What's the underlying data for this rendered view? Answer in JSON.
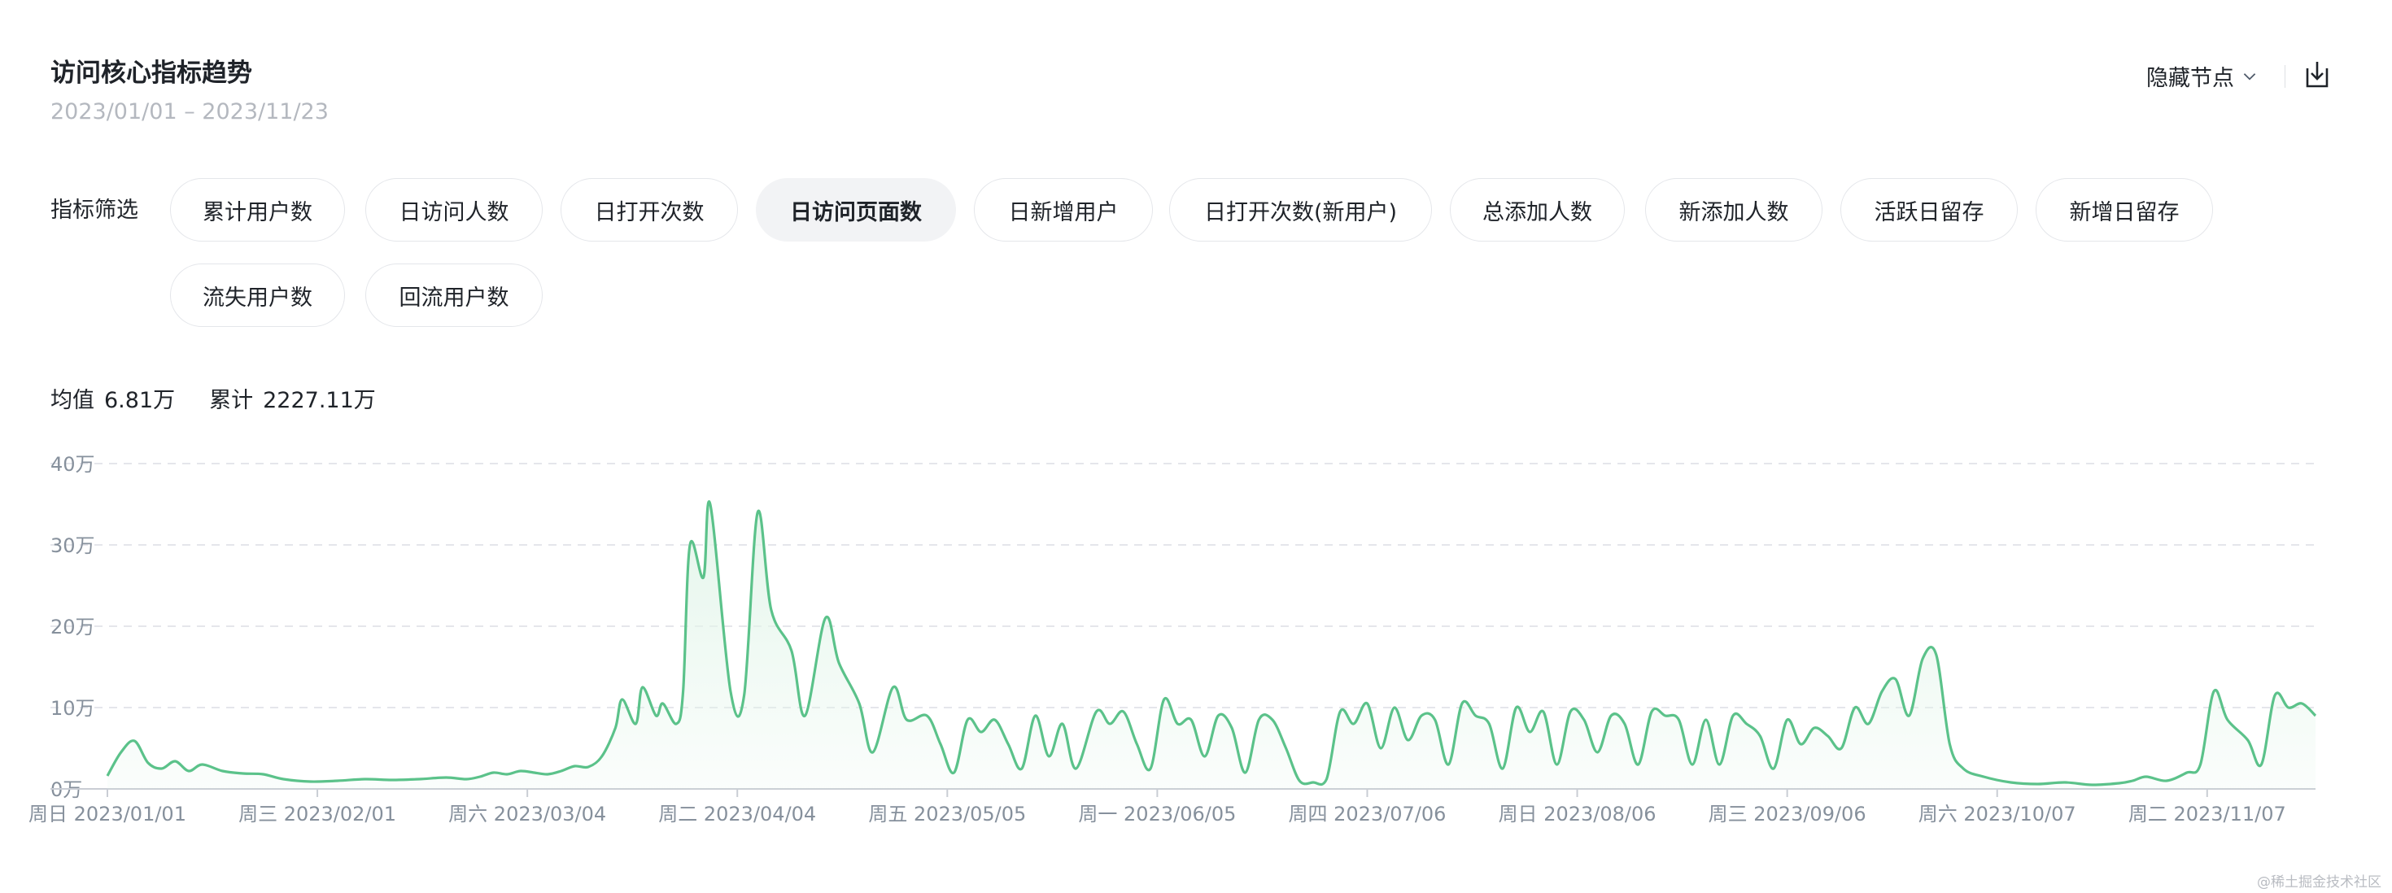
{
  "header": {
    "title": "访问核心指标趋势",
    "date_range": "2023/01/01 – 2023/11/23",
    "hide_nodes_label": "隐藏节点"
  },
  "filters": {
    "label": "指标筛选",
    "items": [
      {
        "label": "累计用户数"
      },
      {
        "label": "日访问人数"
      },
      {
        "label": "日打开次数"
      },
      {
        "label": "日访问页面数",
        "active": true
      },
      {
        "label": "日新增用户"
      },
      {
        "label": "日打开次数(新用户)"
      },
      {
        "label": "总添加人数"
      },
      {
        "label": "新添加人数"
      },
      {
        "label": "活跃日留存"
      },
      {
        "label": "新增日留存"
      },
      {
        "label": "流失用户数"
      },
      {
        "label": "回流用户数"
      }
    ]
  },
  "stats": {
    "mean_label": "均值",
    "mean_value": "6.81万",
    "total_label": "累计",
    "total_value": "2227.11万"
  },
  "watermark": "@稀土掘金技术社区",
  "colors": {
    "line": "#5bc28a",
    "area_top": "#e3f5ea",
    "grid": "#e5e6eb",
    "axis_text": "#86909c",
    "active_pill": "#f2f3f5"
  },
  "chart_data": {
    "type": "area",
    "y_unit": "万",
    "ylim": [
      0,
      40
    ],
    "y_ticks": [
      0,
      10,
      20,
      30,
      40
    ],
    "y_tick_labels": [
      "0万",
      "10万",
      "20万",
      "30万",
      "40万"
    ],
    "xlim": [
      "2023-01-01",
      "2023-11-23"
    ],
    "x_tick_labels": [
      {
        "date": "2023-01-01",
        "label": "周日 2023/01/01"
      },
      {
        "date": "2023-02-01",
        "label": "周三 2023/02/01"
      },
      {
        "date": "2023-03-04",
        "label": "周六 2023/03/04"
      },
      {
        "date": "2023-04-04",
        "label": "周二 2023/04/04"
      },
      {
        "date": "2023-05-05",
        "label": "周五 2023/05/05"
      },
      {
        "date": "2023-06-05",
        "label": "周一 2023/06/05"
      },
      {
        "date": "2023-07-06",
        "label": "周四 2023/07/06"
      },
      {
        "date": "2023-08-06",
        "label": "周日 2023/08/06"
      },
      {
        "date": "2023-09-06",
        "label": "周三 2023/09/06"
      },
      {
        "date": "2023-10-07",
        "label": "周六 2023/10/07"
      },
      {
        "date": "2023-11-07",
        "label": "周二 2023/11/07"
      }
    ],
    "grid": true,
    "series": [
      {
        "points": [
          [
            "2023-01-01",
            1.6
          ],
          [
            "2023-01-03",
            4.5
          ],
          [
            "2023-01-05",
            5.9
          ],
          [
            "2023-01-07",
            3.2
          ],
          [
            "2023-01-09",
            2.5
          ],
          [
            "2023-01-11",
            3.4
          ],
          [
            "2023-01-13",
            2.2
          ],
          [
            "2023-01-15",
            3.0
          ],
          [
            "2023-01-18",
            2.2
          ],
          [
            "2023-01-21",
            1.9
          ],
          [
            "2023-01-24",
            1.8
          ],
          [
            "2023-01-27",
            1.2
          ],
          [
            "2023-01-31",
            0.9
          ],
          [
            "2023-02-04",
            1.0
          ],
          [
            "2023-02-08",
            1.2
          ],
          [
            "2023-02-12",
            1.1
          ],
          [
            "2023-02-16",
            1.2
          ],
          [
            "2023-02-20",
            1.4
          ],
          [
            "2023-02-23",
            1.2
          ],
          [
            "2023-02-25",
            1.5
          ],
          [
            "2023-02-27",
            2.0
          ],
          [
            "2023-03-01",
            1.8
          ],
          [
            "2023-03-03",
            2.2
          ],
          [
            "2023-03-05",
            2.0
          ],
          [
            "2023-03-07",
            1.8
          ],
          [
            "2023-03-09",
            2.2
          ],
          [
            "2023-03-11",
            2.8
          ],
          [
            "2023-03-13",
            2.7
          ],
          [
            "2023-03-15",
            4.0
          ],
          [
            "2023-03-17",
            7.5
          ],
          [
            "2023-03-18",
            11.0
          ],
          [
            "2023-03-20",
            8.0
          ],
          [
            "2023-03-21",
            12.5
          ],
          [
            "2023-03-23",
            9.0
          ],
          [
            "2023-03-24",
            10.5
          ],
          [
            "2023-03-26",
            8.0
          ],
          [
            "2023-03-27",
            12.0
          ],
          [
            "2023-03-28",
            30.0
          ],
          [
            "2023-03-30",
            26.0
          ],
          [
            "2023-03-31",
            35.0
          ],
          [
            "2023-04-03",
            12.0
          ],
          [
            "2023-04-05",
            11.5
          ],
          [
            "2023-04-07",
            34.0
          ],
          [
            "2023-04-09",
            22.0
          ],
          [
            "2023-04-12",
            17.0
          ],
          [
            "2023-04-14",
            9.0
          ],
          [
            "2023-04-17",
            21.0
          ],
          [
            "2023-04-19",
            15.5
          ],
          [
            "2023-04-22",
            10.5
          ],
          [
            "2023-04-24",
            4.5
          ],
          [
            "2023-04-27",
            12.5
          ],
          [
            "2023-04-29",
            8.5
          ],
          [
            "2023-05-02",
            9.0
          ],
          [
            "2023-05-04",
            5.5
          ],
          [
            "2023-05-06",
            2.0
          ],
          [
            "2023-05-08",
            8.5
          ],
          [
            "2023-05-10",
            7.0
          ],
          [
            "2023-05-12",
            8.5
          ],
          [
            "2023-05-14",
            5.5
          ],
          [
            "2023-05-16",
            2.5
          ],
          [
            "2023-05-18",
            9.0
          ],
          [
            "2023-05-20",
            4.0
          ],
          [
            "2023-05-22",
            8.0
          ],
          [
            "2023-05-24",
            2.5
          ],
          [
            "2023-05-27",
            9.5
          ],
          [
            "2023-05-29",
            8.0
          ],
          [
            "2023-05-31",
            9.5
          ],
          [
            "2023-06-02",
            5.5
          ],
          [
            "2023-06-04",
            2.5
          ],
          [
            "2023-06-06",
            11.0
          ],
          [
            "2023-06-08",
            8.0
          ],
          [
            "2023-06-10",
            8.5
          ],
          [
            "2023-06-12",
            4.0
          ],
          [
            "2023-06-14",
            9.0
          ],
          [
            "2023-06-16",
            7.5
          ],
          [
            "2023-06-18",
            2.0
          ],
          [
            "2023-06-20",
            8.5
          ],
          [
            "2023-06-22",
            8.5
          ],
          [
            "2023-06-24",
            5.0
          ],
          [
            "2023-06-26",
            1.0
          ],
          [
            "2023-06-28",
            0.8
          ],
          [
            "2023-06-30",
            1.2
          ],
          [
            "2023-07-02",
            9.5
          ],
          [
            "2023-07-04",
            8.0
          ],
          [
            "2023-07-06",
            10.5
          ],
          [
            "2023-07-08",
            5.0
          ],
          [
            "2023-07-10",
            10.0
          ],
          [
            "2023-07-12",
            6.0
          ],
          [
            "2023-07-14",
            9.0
          ],
          [
            "2023-07-16",
            8.5
          ],
          [
            "2023-07-18",
            3.0
          ],
          [
            "2023-07-20",
            10.5
          ],
          [
            "2023-07-22",
            9.0
          ],
          [
            "2023-07-24",
            8.0
          ],
          [
            "2023-07-26",
            2.5
          ],
          [
            "2023-07-28",
            10.0
          ],
          [
            "2023-07-30",
            7.0
          ],
          [
            "2023-08-01",
            9.5
          ],
          [
            "2023-08-03",
            3.0
          ],
          [
            "2023-08-05",
            9.5
          ],
          [
            "2023-08-07",
            8.5
          ],
          [
            "2023-08-09",
            4.5
          ],
          [
            "2023-08-11",
            9.0
          ],
          [
            "2023-08-13",
            8.0
          ],
          [
            "2023-08-15",
            3.0
          ],
          [
            "2023-08-17",
            9.5
          ],
          [
            "2023-08-19",
            9.0
          ],
          [
            "2023-08-21",
            8.5
          ],
          [
            "2023-08-23",
            3.0
          ],
          [
            "2023-08-25",
            8.5
          ],
          [
            "2023-08-27",
            3.0
          ],
          [
            "2023-08-29",
            9.0
          ],
          [
            "2023-08-31",
            8.0
          ],
          [
            "2023-09-02",
            6.5
          ],
          [
            "2023-09-04",
            2.5
          ],
          [
            "2023-09-06",
            8.5
          ],
          [
            "2023-09-08",
            5.5
          ],
          [
            "2023-09-10",
            7.5
          ],
          [
            "2023-09-12",
            6.5
          ],
          [
            "2023-09-14",
            5.0
          ],
          [
            "2023-09-16",
            10.0
          ],
          [
            "2023-09-18",
            8.0
          ],
          [
            "2023-09-20",
            12.0
          ],
          [
            "2023-09-22",
            13.5
          ],
          [
            "2023-09-24",
            9.0
          ],
          [
            "2023-09-26",
            16.0
          ],
          [
            "2023-09-28",
            16.5
          ],
          [
            "2023-09-30",
            5.5
          ],
          [
            "2023-10-02",
            2.5
          ],
          [
            "2023-10-05",
            1.5
          ],
          [
            "2023-10-09",
            0.8
          ],
          [
            "2023-10-13",
            0.6
          ],
          [
            "2023-10-17",
            0.8
          ],
          [
            "2023-10-21",
            0.5
          ],
          [
            "2023-10-25",
            0.7
          ],
          [
            "2023-10-27",
            1.0
          ],
          [
            "2023-10-29",
            1.5
          ],
          [
            "2023-11-01",
            1.0
          ],
          [
            "2023-11-04",
            2.0
          ],
          [
            "2023-11-06",
            3.0
          ],
          [
            "2023-11-08",
            12.0
          ],
          [
            "2023-11-10",
            8.5
          ],
          [
            "2023-11-13",
            6.0
          ],
          [
            "2023-11-15",
            3.0
          ],
          [
            "2023-11-17",
            11.5
          ],
          [
            "2023-11-19",
            10.0
          ],
          [
            "2023-11-21",
            10.5
          ],
          [
            "2023-11-23",
            9.0
          ]
        ]
      }
    ]
  }
}
